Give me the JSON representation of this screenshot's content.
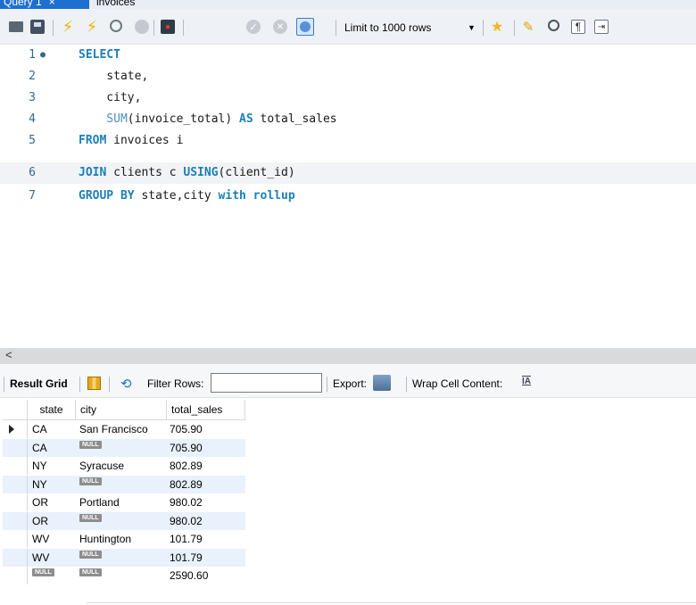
{
  "tabs": [
    {
      "label": "Query 1",
      "close": "×",
      "active": true
    },
    {
      "label": "invoices",
      "active": false
    }
  ],
  "toolbar": {
    "limit_select": "Limit to 1000 rows",
    "icons": [
      "folder-icon",
      "save-icon",
      "execute-icon",
      "execute-current-icon",
      "explain-icon",
      "stop-icon",
      "toggle-error-icon",
      "commit-icon",
      "rollback-icon",
      "autocommit-icon",
      "add-snippet-icon",
      "beautify-icon",
      "find-icon",
      "invisible-chars-icon",
      "wrap-lines-icon"
    ]
  },
  "editor": {
    "lines": [
      {
        "no": "1",
        "bullet": "●"
      },
      {
        "no": "2"
      },
      {
        "no": "3"
      },
      {
        "no": "4"
      },
      {
        "no": "5"
      },
      {
        "no": "6"
      },
      {
        "no": "7"
      }
    ],
    "tokens": {
      "l1_kw": "SELECT",
      "l2": "    state,",
      "l3": "    city,",
      "l4_fn": "    SUM",
      "l4_a": "(invoice_total) ",
      "l4_kw": "AS",
      "l4_b": " total_sales",
      "l5_kw": "FROM",
      "l5_a": " invoices i",
      "l6_kw": "JOIN",
      "l6_a": " clients c ",
      "l6_kw2": "USING",
      "l6_b": "(client_id)",
      "l7_kw": "GROUP BY",
      "l7_a": " state,city ",
      "l7_kw2": "with rollup"
    }
  },
  "scrollbar": {
    "left_arrow": "<"
  },
  "result_toolbar": {
    "result_grid": "Result Grid",
    "filter_rows": "Filter Rows:",
    "filter_value": "",
    "export": "Export:",
    "wrap_cell": "Wrap Cell Content:",
    "wrap_icon": "IA"
  },
  "grid": {
    "columns": [
      "state",
      "city",
      "total_sales"
    ],
    "null_label": "NULL",
    "rows": [
      {
        "state": "CA",
        "city": "San Francisco",
        "total": "705.90"
      },
      {
        "state": "CA",
        "city": "NULL",
        "total": "705.90"
      },
      {
        "state": "NY",
        "city": "Syracuse",
        "total": "802.89"
      },
      {
        "state": "NY",
        "city": "NULL",
        "total": "802.89"
      },
      {
        "state": "OR",
        "city": "Portland",
        "total": "980.02"
      },
      {
        "state": "OR",
        "city": "NULL",
        "total": "980.02"
      },
      {
        "state": "WV",
        "city": "Huntington",
        "total": "101.79"
      },
      {
        "state": "WV",
        "city": "NULL",
        "total": "101.79"
      },
      {
        "state": "NULL",
        "city": "NULL",
        "total": "2590.60"
      }
    ]
  }
}
